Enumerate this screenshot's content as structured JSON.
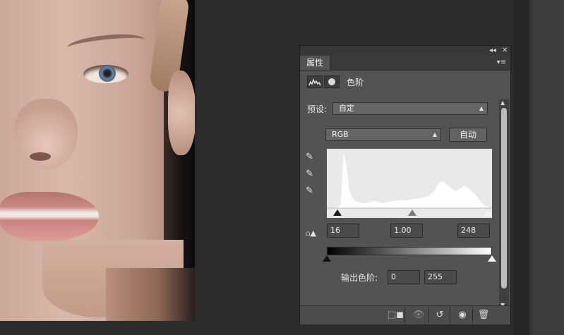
{
  "panel": {
    "tab_label": "属性",
    "title": "色阶",
    "preset_label": "预设:",
    "preset_value": "自定",
    "channel_value": "RGB",
    "auto_label": "自动",
    "input_black": "16",
    "input_gamma": "1.00",
    "input_white": "248",
    "output_label": "输出色阶:",
    "output_black": "0",
    "output_white": "255",
    "collapse_icon": "double-chevron-left-icon",
    "close_icon": "close-icon",
    "menu_icon": "panel-menu-icon"
  },
  "histogram": {
    "levels": [
      0,
      0,
      0,
      0,
      2,
      5,
      92,
      70,
      30,
      18,
      12,
      10,
      9,
      8,
      8,
      9,
      10,
      12,
      10,
      9,
      8,
      9,
      10,
      11,
      12,
      12,
      13,
      13,
      12,
      13,
      14,
      15,
      15,
      16,
      17,
      18,
      19,
      22,
      26,
      32,
      40,
      44,
      42,
      38,
      34,
      30,
      28,
      30,
      33,
      36,
      34,
      30,
      26,
      22,
      16,
      10,
      6,
      3,
      1,
      0
    ],
    "input_black": 16,
    "input_gamma": 1.0,
    "input_white": 248,
    "output_black": 0,
    "output_white": 255
  },
  "colors": {
    "panel_bg": "#535353",
    "workspace_bg": "#2b2b2b",
    "histogram_bg": "#e9e9e9"
  }
}
